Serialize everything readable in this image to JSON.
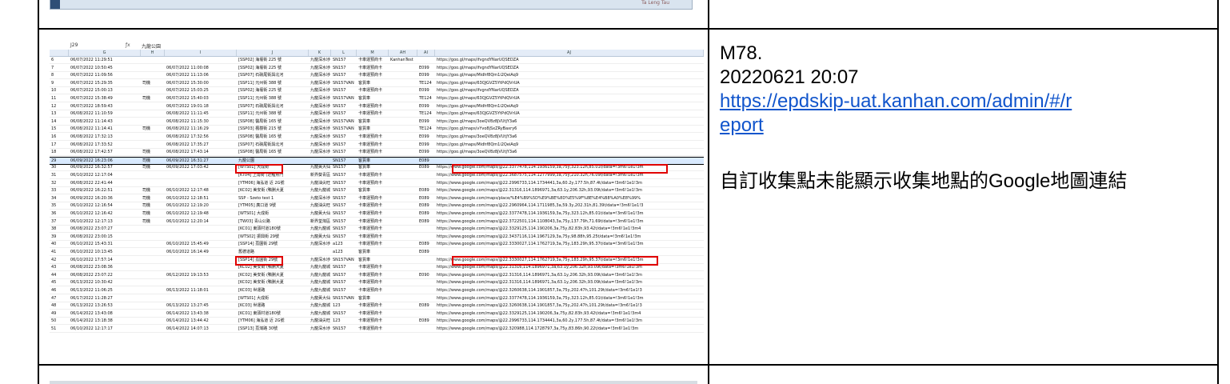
{
  "top_image": {
    "label": "Ta Leng Tau"
  },
  "spreadsheet": {
    "cell_ref": "J29",
    "formula_value": "九龍公園",
    "columns": [
      "G",
      "H",
      "I",
      "J",
      "K",
      "L",
      "M",
      "AH",
      "AI",
      "AJ"
    ],
    "rows": [
      {
        "rn": "6",
        "g": "06/07/2022 11:29:51",
        "h": "",
        "i": "",
        "j": "[SSP02] 海壇街 225 號",
        "k": "九龍深水埗",
        "l": "SN157",
        "m": "卡車運預商卡",
        "ah": "KanhanTest",
        "ai": "",
        "aj": "https://goo.gl/maps/ifvgndYNarUQSEDZA"
      },
      {
        "rn": "7",
        "g": "06/07/2022 10:50:45",
        "h": "",
        "i": "06/07/2022 11:00:08",
        "j": "[SSP02] 海壇街 225 號",
        "k": "九龍深水埗",
        "l": "SN157",
        "m": "卡車運預商卡",
        "ah": "",
        "ai": "E099",
        "aj": "https://goo.gl/maps/ifvgndYNarUQSEDZA"
      },
      {
        "rn": "8",
        "g": "06/07/2022 11:09:56",
        "h": "",
        "i": "06/07/2022 11:13:06",
        "j": "[SSP07] 石硤尾街與北河",
        "k": "九龍深水埗",
        "l": "SN157",
        "m": "卡車運預商卡",
        "ah": "",
        "ai": "E099",
        "aj": "https://goo.gl/maps/Midhf8Qm1i2QeiAq9"
      },
      {
        "rn": "9",
        "g": "06/07/2022 15:29:35",
        "h": "司機",
        "i": "06/07/2022 15:30:00",
        "j": "[SSP11] 元州街 388 號",
        "k": "九龍深水埗",
        "l": "SN157VAN",
        "m": "客貨車",
        "ah": "",
        "ai": "TE124",
        "aj": "https://goo.gl/maps/63QJGVZ5YtPdQVrUA"
      },
      {
        "rn": "10",
        "g": "06/07/2022 15:00:13",
        "h": "",
        "i": "06/07/2022 15:03:25",
        "j": "[SSP02] 海壇街 225 號",
        "k": "九龍深水埗",
        "l": "SN157",
        "m": "卡車運預商卡",
        "ah": "",
        "ai": "E099",
        "aj": "https://goo.gl/maps/ifvgndYNarUQSEDZA"
      },
      {
        "rn": "11",
        "g": "06/07/2022 15:38:49",
        "h": "司機",
        "i": "06/07/2022 15:40:03",
        "j": "[SSP11] 元州街 388 號",
        "k": "九龍深水埗",
        "l": "SN157VAN",
        "m": "客貨車",
        "ah": "",
        "ai": "TE124",
        "aj": "https://goo.gl/maps/63QJGVZ5YtPdQVrUA"
      },
      {
        "rn": "12",
        "g": "06/07/2022 18:59:43",
        "h": "",
        "i": "06/07/2022 19:01:18",
        "j": "[SSP07] 石硤尾街與北河",
        "k": "九龍深水埗",
        "l": "SN157",
        "m": "卡車運預商卡",
        "ah": "",
        "ai": "E099",
        "aj": "https://goo.gl/maps/Midhf8Qm1i2QeiAq9"
      },
      {
        "rn": "13",
        "g": "06/08/2022 11:10:59",
        "h": "",
        "i": "06/08/2022 11:11:45",
        "j": "[SSP11] 元州街 388 號",
        "k": "九龍深水埗",
        "l": "SN157",
        "m": "卡車運預商卡",
        "ah": "",
        "ai": "TE124",
        "aj": "https://goo.gl/maps/63QJGVZ5YtPdQVrUA"
      },
      {
        "rn": "14",
        "g": "06/08/2022 11:14:43",
        "h": "",
        "i": "06/08/2022 11:15:30",
        "j": "[SSP08] 醫局街 165 號",
        "k": "九龍深水埗",
        "l": "SN157VAN",
        "m": "客貨車",
        "ah": "",
        "ai": "E099",
        "aj": "https://goo.gl/maps/3oeQV8z8jVUtjY3a6"
      },
      {
        "rn": "15",
        "g": "06/08/2022 11:14:41",
        "h": "司機",
        "i": "06/08/2022 11:16:29",
        "j": "[SSP03] 楓樹街 215 號",
        "k": "九龍深水埗",
        "l": "SN157VAN",
        "m": "客貨車",
        "ah": "",
        "ai": "TE124",
        "aj": "https://goo.gl/maps/vYvo8jSxZRyBaxry6"
      },
      {
        "rn": "16",
        "g": "06/08/2022 17:32:13",
        "h": "",
        "i": "06/08/2022 17:32:56",
        "j": "[SSP08] 醫局街 165 號",
        "k": "九龍深水埗",
        "l": "SN157",
        "m": "卡車運預商卡",
        "ah": "",
        "ai": "E099",
        "aj": "https://goo.gl/maps/3oeQV8z8jVUtjY3a6"
      },
      {
        "rn": "17",
        "g": "06/08/2022 17:33:52",
        "h": "",
        "i": "06/08/2022 17:35:27",
        "j": "[SSP07] 石硤尾街與北河",
        "k": "九龍深水埗",
        "l": "SN157",
        "m": "卡車運預商卡",
        "ah": "",
        "ai": "E099",
        "aj": "https://goo.gl/maps/Midhf8Qm1i2QeiAq9"
      },
      {
        "rn": "18",
        "g": "06/08/2022 17:42:57",
        "h": "司機",
        "i": "06/08/2022 17:43:14",
        "j": "[SSP08] 醫局街 165 號",
        "k": "九龍深水埗",
        "l": "SN157",
        "m": "卡車運預商卡",
        "ah": "",
        "ai": "E099",
        "aj": "https://goo.gl/maps/3oeQV8z8jVUtjY3a6"
      },
      {
        "rn": "29",
        "g": "06/09/2022 16:23:06",
        "h": "司機",
        "i": "06/09/2022 16:31:27",
        "j": "九龍公園",
        "k": "",
        "l": "SN157",
        "m": "客貨車",
        "ah": "",
        "ai": "E089",
        "aj": ""
      },
      {
        "rn": "30",
        "g": "06/09/2022 16:32:57",
        "h": "司機",
        "i": "06/09/2022 17:03:42",
        "j": "[WTS01] 大成街",
        "k": "九龍黃大仙",
        "l": "SN157",
        "m": "客貨車",
        "ah": "",
        "ai": "E089",
        "aj": "https://www.google.com/maps/@22.3377478,114.1936159,3a,75y,323.12h,85.01t/data=!3m6!1e1!3m"
      },
      {
        "rn": "31",
        "g": "06/10/2022 12:17:04",
        "h": "",
        "i": "",
        "j": "[KT04] 上角街 (近鯉魚門",
        "k": "新界葵青區",
        "l": "SN157",
        "m": "卡車運預商卡",
        "ah": "",
        "ai": "",
        "aj": "https://www.google.com/maps/@22.3687575,114.1277999,3a,75y,210.32h,76.09t/data=!3m6!1e1!3m"
      },
      {
        "rn": "32",
        "g": "06/08/2022 22:41:44",
        "h": "",
        "i": "",
        "j": "[YTM06] 海泓道 近 2G號",
        "k": "九龍油尖旺",
        "l": "SN157",
        "m": "卡車運預商卡",
        "ah": "",
        "ai": "",
        "aj": "https://www.google.com/maps/@22.2996733,114.1734441,3a,60.2y,177.5h,87.4t/data=!3m6!1e1!3m"
      },
      {
        "rn": "33",
        "g": "06/09/2022 16:22:51",
        "h": "司機",
        "i": "06/10/2022 12:17:48",
        "j": "[KC02] 美安街 (鴨脷大夏",
        "k": "九龍九龍城",
        "l": "SN157",
        "m": "客貨車",
        "ah": "",
        "ai": "E089",
        "aj": "https://www.google.com/maps/@22.31316,114.1896971,3a,63.1y,206.32h,93.09t/data=!3m6!1e1!3m"
      },
      {
        "rn": "34",
        "g": "06/09/2022 16:20:36",
        "h": "司機",
        "i": "06/10/2022 12:18:51",
        "j": "SSP - Szeto test 1",
        "k": "九龍深水埗",
        "l": "SN157",
        "m": "卡車運預商卡",
        "ah": "",
        "ai": "E089",
        "aj": "https://www.google.com/maps/place/%E4%B9%5D%E9%BE%8D%E5%9F%8E%E4%B8%A0%E8%99%"
      },
      {
        "rn": "35",
        "g": "06/10/2022 12:16:54",
        "h": "司機",
        "i": "06/10/2022 12:19:20",
        "j": "[YTM05] 廣口道 9號",
        "k": "九龍油尖旺",
        "l": "SN157",
        "m": "卡車運預商卡",
        "ah": "",
        "ai": "E089",
        "aj": "https://www.google.com/maps/@22.2960964,114.1711985,3a,59.3y,202.31h,81.39t/data=!3m6!1e1!3"
      },
      {
        "rn": "36",
        "g": "06/10/2022 12:16:42",
        "h": "司機",
        "i": "06/10/2022 12:19:48",
        "j": "[WTS01] 大成街",
        "k": "九龍黃大仙",
        "l": "SN157",
        "m": "卡車運預商卡",
        "ah": "",
        "ai": "E089",
        "aj": "https://www.google.com/maps/@22.3377478,114.1936159,3a,75y,323.12h,85.01t/data=!3m6!1e1!3m"
      },
      {
        "rn": "37",
        "g": "06/10/2022 12:17:13",
        "h": "司機",
        "i": "06/10/2022 12:20:14",
        "j": "[TW03] 青山公路",
        "k": "新界荃灣區",
        "l": "SN157",
        "m": "卡車運預商卡",
        "ah": "",
        "ai": "E089",
        "aj": "https://www.google.com/maps/@22.3722501,114.1108043,3a,75y,137.79h,71.69t/data=!3m6!1e1!3m"
      },
      {
        "rn": "38",
        "g": "06/08/2022 23:07:27",
        "h": "",
        "i": "",
        "j": "[KC01] 東頭村道180號",
        "k": "九龍九龍城",
        "l": "SN157",
        "m": "卡車運預商卡",
        "ah": "",
        "ai": "",
        "aj": "https://www.google.com/maps/@22.3329125,114.190206,3a,75y,82.83h,93.42t/data=!3m6!1e1!3m4"
      },
      {
        "rn": "39",
        "g": "06/08/2022 23:00:15",
        "h": "",
        "i": "",
        "j": "[WTS02] 振興街 29號",
        "k": "九龍黃大仙",
        "l": "SN157",
        "m": "卡車運預商卡",
        "ah": "",
        "ai": "",
        "aj": "https://www.google.com/maps/@22.3437116,114.1967129,3a,75y,98.88h,95.25t/data=!3m6!1e1!3m"
      },
      {
        "rn": "40",
        "g": "06/10/2022 15:43:31",
        "h": "",
        "i": "06/10/2022 15:45:49",
        "j": "[SSP14] 荔園街 29號",
        "k": "九龍深水埗",
        "l": "a123",
        "m": "卡車運預商卡",
        "ah": "",
        "ai": "E089",
        "aj": "https://www.google.com/maps/@22.3330027,114.1762719,3a,75y,183.29h,95.37t/data=!3m6!1e1!3m"
      },
      {
        "rn": "41",
        "g": "06/10/2022 10:13:45",
        "h": "",
        "i": "06/10/2022 16:14:49",
        "j": "舊德道路",
        "k": "",
        "l": "a123",
        "m": "客貨車",
        "ah": "",
        "ai": "E089",
        "aj": ""
      },
      {
        "rn": "42",
        "g": "06/10/2022 17:57:14",
        "h": "",
        "i": "",
        "j": "[SSP14] 荔園街 29號",
        "k": "九龍深水埗",
        "l": "SN157VAN",
        "m": "客貨車",
        "ah": "",
        "ai": "",
        "aj": "https://www.google.com/maps/@22.3330027,114.1762719,3a,75y,183.29h,95.37t/data=!3m6!1e1!3m"
      },
      {
        "rn": "43",
        "g": "06/08/2022 23:08:36",
        "h": "",
        "i": "",
        "j": "[KC02] 美安街 (鴨脷大夏",
        "k": "九龍九龍城",
        "l": "SN157",
        "m": "卡車運預商卡",
        "ah": "",
        "ai": "",
        "aj": "https://www.google.com/maps/@22.31316,114.1896971,3a,63.1y,206.32h,93.09t/data=!3m6!1e1!3m"
      },
      {
        "rn": "44",
        "g": "06/08/2022 23:07:22",
        "h": "",
        "i": "06/12/2022 19:13:53",
        "j": "[KC02] 美安街 (鴨脷大夏",
        "k": "九龍九龍城",
        "l": "SN157",
        "m": "卡車運預商卡",
        "ah": "",
        "ai": "E090",
        "aj": "https://www.google.com/maps/@22.31316,114.1896971,3a,63.1y,206.32h,93.09t/data=!3m6!1e1!3m"
      },
      {
        "rn": "45",
        "g": "06/13/2022 10:30:42",
        "h": "",
        "i": "",
        "j": "[KC02] 美安街 (鴨脷大夏",
        "k": "九龍九龍城",
        "l": "SN157",
        "m": "卡車運預商卡",
        "ah": "",
        "ai": "",
        "aj": "https://www.google.com/maps/@22.31316,114.1896971,3a,63.1y,206.32h,93.09t/data=!3m6!1e1!3m"
      },
      {
        "rn": "46",
        "g": "06/13/2022 11:06:25",
        "h": "",
        "i": "06/13/2022 11:18:01",
        "j": "[KC03] 世運路",
        "k": "九龍九龍城",
        "l": "SN157",
        "m": "卡車運預商卡",
        "ah": "",
        "ai": "",
        "aj": "https://www.google.com/maps/@22.3260638,114.1901857,3a,75y,202.47h,101.29t/data=!3m6!1e1!3"
      },
      {
        "rn": "47",
        "g": "06/17/2022 11:28:27",
        "h": "",
        "i": "",
        "j": "[WTS01] 大成街",
        "k": "九龍黃大仙",
        "l": "SN157VAN",
        "m": "客貨車",
        "ah": "",
        "ai": "",
        "aj": "https://www.google.com/maps/@22.3377478,114.1936159,3a,75y,323.12h,85.01t/data=!3m6!1e1!3m"
      },
      {
        "rn": "48",
        "g": "06/13/2022 13:26:53",
        "h": "",
        "i": "06/13/2022 13:27:45",
        "j": "[KC03] 世運路",
        "k": "九龍九龍城",
        "l": "123",
        "m": "卡車運預商卡",
        "ah": "",
        "ai": "E089",
        "aj": "https://www.google.com/maps/@22.3260638,114.1901857,3a,75y,202.47h,101.29t/data=!3m6!1e1!3"
      },
      {
        "rn": "49",
        "g": "06/14/2022 13:43:08",
        "h": "",
        "i": "06/14/2022 13:43:38",
        "j": "[KC01] 東頭村道180號",
        "k": "九龍九龍城",
        "l": "SN157",
        "m": "卡車運預商卡",
        "ah": "",
        "ai": "",
        "aj": "https://www.google.com/maps/@22.3329125,114.190206,3a,75y,82.83h,93.42t/data=!3m6!1e1!3m4"
      },
      {
        "rn": "50",
        "g": "06/14/2022 13:18:38",
        "h": "",
        "i": "06/14/2022 13:44:42",
        "j": "[YTM06] 海泓道 近 2G號",
        "k": "九龍油尖旺",
        "l": "123",
        "m": "卡車運預商卡",
        "ah": "",
        "ai": "E089",
        "aj": "https://www.google.com/maps/@22.2996733,114.1734441,3a,60.2y,177.5h,87.4t/data=!3m6!1e1!3m"
      },
      {
        "rn": "51",
        "g": "06/10/2022 12:17:17",
        "h": "",
        "i": "06/14/2022 14:07:13",
        "j": "[SSP13] 荔灣路 30號",
        "k": "九龍深水埗",
        "l": "SN157",
        "m": "卡車運預商卡",
        "ah": "",
        "ai": "",
        "aj": "https://www.google.com/maps/@22.320988,114.1728797,3a,75y,83.86h,90.22t/data=!3m6!1e1!3m"
      }
    ]
  },
  "note": {
    "code": "M78.",
    "datetime": "20220621 20:07",
    "link": "https://epdskip-uat.kanhan.com/admin/#/report",
    "link_line1": "https://epdskip-uat.kanhan.com/admin/#/r",
    "link_line2": "eport",
    "description": "自訂收集點未能顯示收集地點的Google地圖連結"
  }
}
